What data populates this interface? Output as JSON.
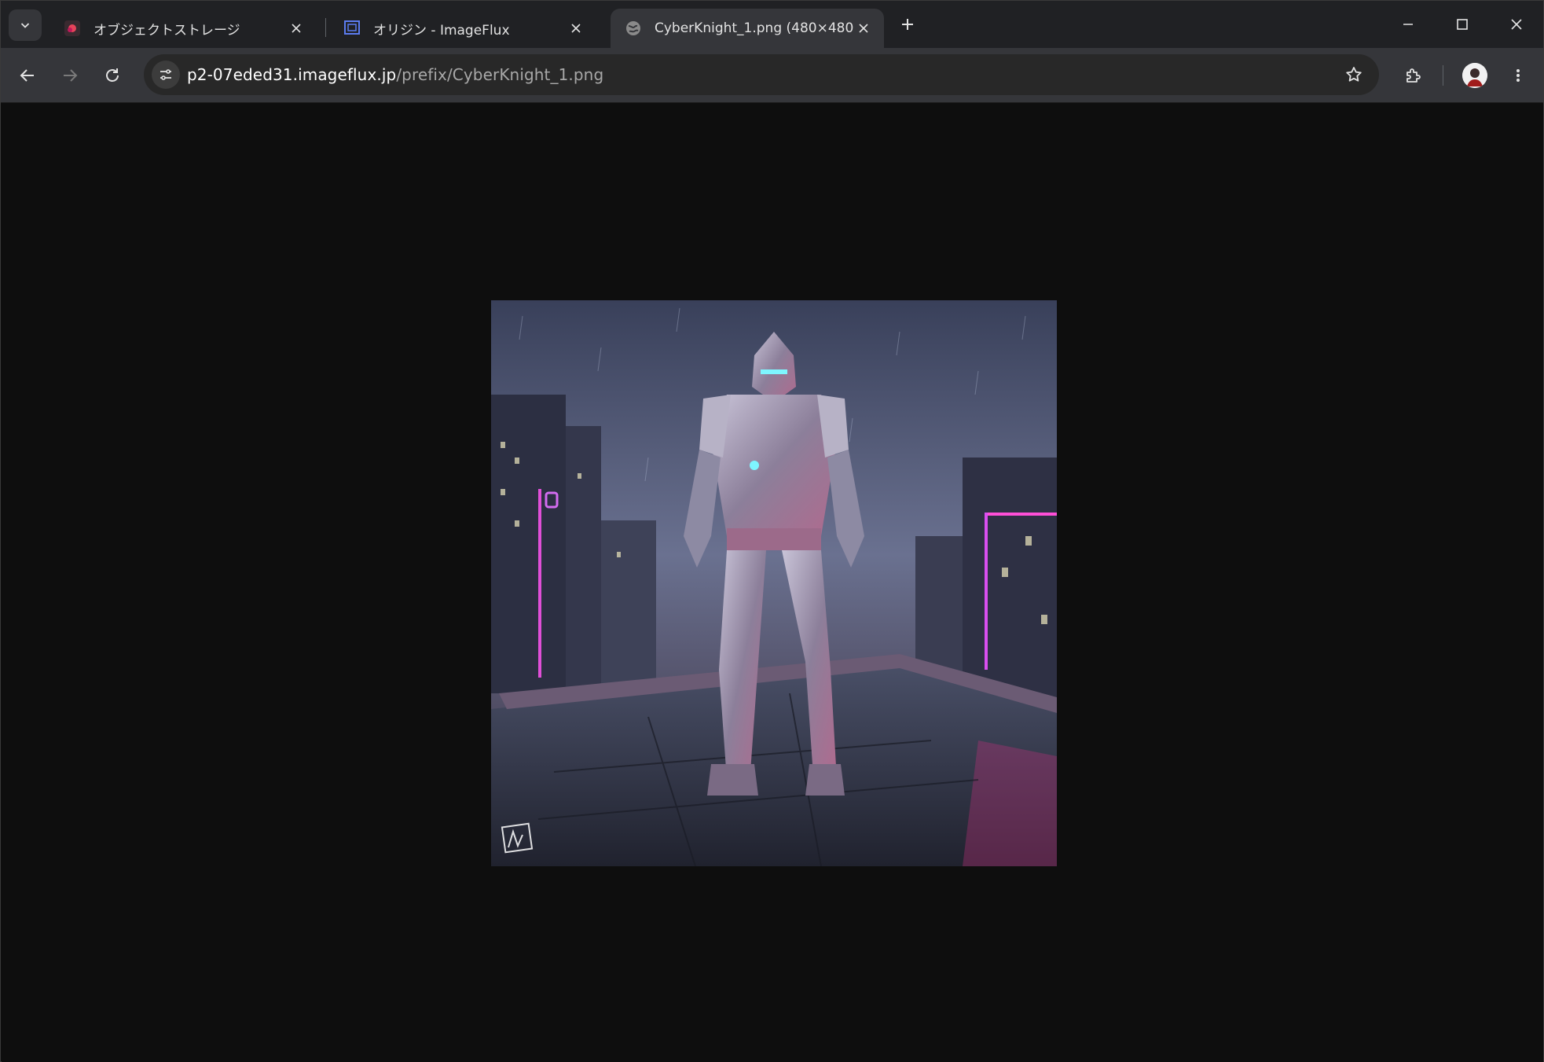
{
  "tabs": [
    {
      "title": "オブジェクトストレージ",
      "active": false,
      "favicon": "storage-icon"
    },
    {
      "title": "オリジン - ImageFlux",
      "active": false,
      "favicon": "imageflux-icon"
    },
    {
      "title": "CyberKnight_1.png (480×480)",
      "active": true,
      "favicon": "globe-icon"
    }
  ],
  "address_bar": {
    "host": "p2-07eded31.imageflux.jp",
    "path": "/prefix/CyberKnight_1.png"
  },
  "content": {
    "image_alt": "CyberKnight_1.png",
    "image_description_icon": "cyber-knight-image"
  },
  "colors": {
    "tab_strip": "#202124",
    "toolbar": "#35363a",
    "page_background": "#0e0e0e"
  }
}
